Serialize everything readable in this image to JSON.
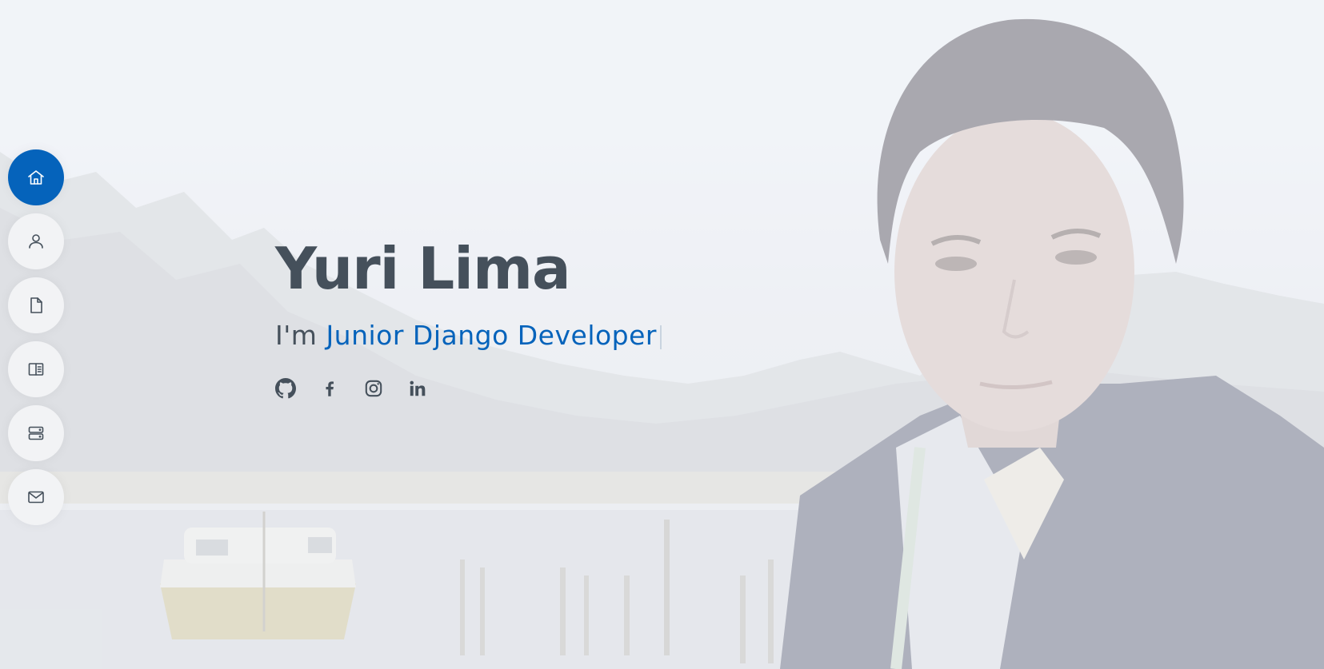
{
  "hero": {
    "name": "Yuri Lima",
    "subtitle_prefix": "I'm",
    "typed_text": "Junior Django Developer"
  },
  "nav": {
    "items": [
      {
        "icon": "home-icon",
        "active": true
      },
      {
        "icon": "user-icon",
        "active": false
      },
      {
        "icon": "file-icon",
        "active": false
      },
      {
        "icon": "book-half-icon",
        "active": false
      },
      {
        "icon": "server-icon",
        "active": false
      },
      {
        "icon": "envelope-icon",
        "active": false
      }
    ]
  },
  "social": {
    "links": [
      {
        "icon": "github-icon"
      },
      {
        "icon": "facebook-icon"
      },
      {
        "icon": "instagram-icon"
      },
      {
        "icon": "linkedin-icon"
      }
    ]
  },
  "colors": {
    "accent": "#0563bb",
    "text": "#45505b",
    "nav_bg": "#f2f3f5"
  }
}
